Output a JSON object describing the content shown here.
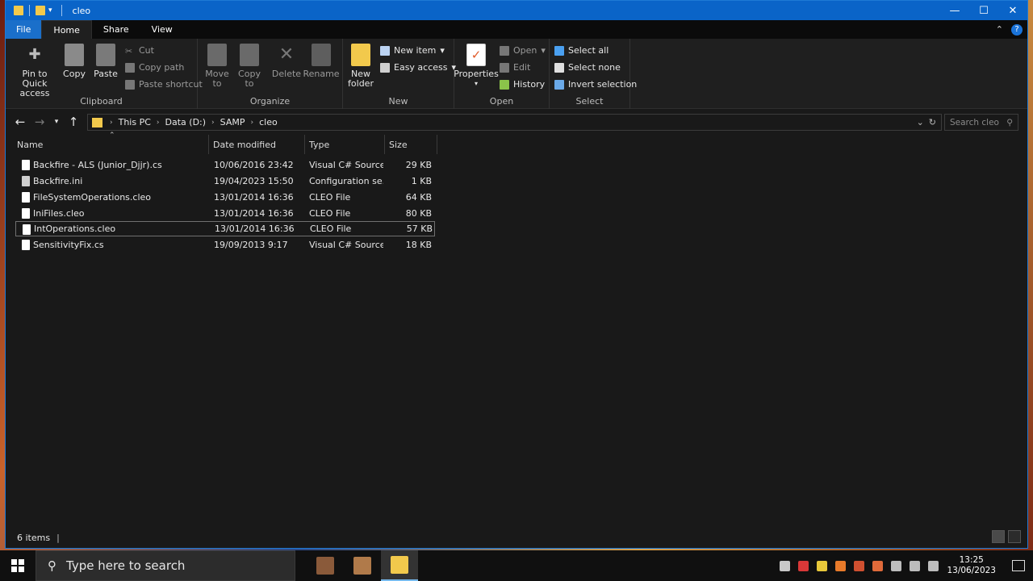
{
  "window": {
    "title": "cleo"
  },
  "ribbon_tabs": [
    "File",
    "Home",
    "Share",
    "View"
  ],
  "ribbon": {
    "clipboard": {
      "pin": "Pin to Quick access",
      "copy": "Copy",
      "paste": "Paste",
      "cut": "Cut",
      "copy_path": "Copy path",
      "paste_shortcut": "Paste shortcut",
      "label": "Clipboard"
    },
    "organize": {
      "move_to": "Move to",
      "copy_to": "Copy to",
      "delete": "Delete",
      "rename": "Rename",
      "label": "Organize"
    },
    "new": {
      "new_folder": "New folder",
      "new_item": "New item",
      "easy_access": "Easy access",
      "label": "New"
    },
    "open": {
      "properties": "Properties",
      "open": "Open",
      "edit": "Edit",
      "history": "History",
      "label": "Open"
    },
    "select": {
      "select_all": "Select all",
      "select_none": "Select none",
      "invert": "Invert selection",
      "label": "Select"
    }
  },
  "address": {
    "crumbs": [
      "This PC",
      "Data (D:)",
      "SAMP",
      "cleo"
    ],
    "search_placeholder": "Search cleo"
  },
  "columns": {
    "name": "Name",
    "date": "Date modified",
    "type": "Type",
    "size": "Size"
  },
  "files": [
    {
      "name": "Backfire - ALS (Junior_Djjr).cs",
      "date": "10/06/2016 23:42",
      "type": "Visual C# Source...",
      "size": "29 KB"
    },
    {
      "name": "Backfire.ini",
      "date": "19/04/2023 15:50",
      "type": "Configuration se...",
      "size": "1 KB"
    },
    {
      "name": "FileSystemOperations.cleo",
      "date": "13/01/2014 16:36",
      "type": "CLEO File",
      "size": "64 KB"
    },
    {
      "name": "IniFiles.cleo",
      "date": "13/01/2014 16:36",
      "type": "CLEO File",
      "size": "80 KB"
    },
    {
      "name": "IntOperations.cleo",
      "date": "13/01/2014 16:36",
      "type": "CLEO File",
      "size": "57 KB"
    },
    {
      "name": "SensitivityFix.cs",
      "date": "19/09/2013 9:17",
      "type": "Visual C# Source...",
      "size": "18 KB"
    }
  ],
  "status": {
    "items": "6 items"
  },
  "taskbar": {
    "search_placeholder": "Type here to search",
    "time": "13:25",
    "date": "13/06/2023"
  },
  "colors": {
    "accent": "#0a64c8",
    "file_tab": "#1a6fca",
    "folder": "#f2c94c"
  }
}
